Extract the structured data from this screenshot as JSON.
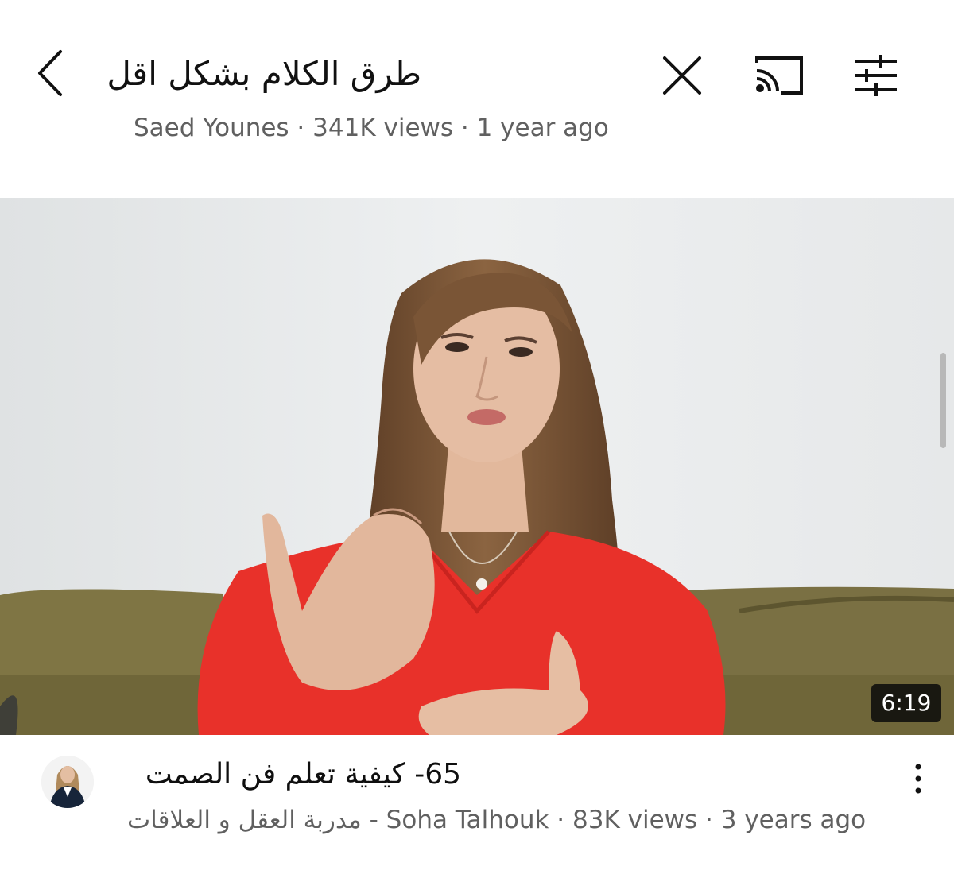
{
  "search": {
    "query": "طرق الكلام بشكل اقل"
  },
  "toolbar": {
    "icons": [
      "chevron-left-icon",
      "close-icon",
      "cast-icon",
      "filter-sliders-icon"
    ]
  },
  "previous_result": {
    "meta": "Saed Younes · 341K views · 1 year ago"
  },
  "result": {
    "duration": "6:19",
    "title": "65-  كيفية تعلم فن الصمت",
    "channel_arabic": "مدربة العقل و العلاقات",
    "channel_separator": " - ",
    "channel_latin": "Soha Talhouk",
    "views": "83K views",
    "age": "3 years ago",
    "dot": " · "
  },
  "colors": {
    "text_primary": "#0f0f0f",
    "text_secondary": "#606060",
    "shirt_red": "#e8312a",
    "sofa_olive": "#7d7341",
    "wall": "#e9ebec"
  }
}
